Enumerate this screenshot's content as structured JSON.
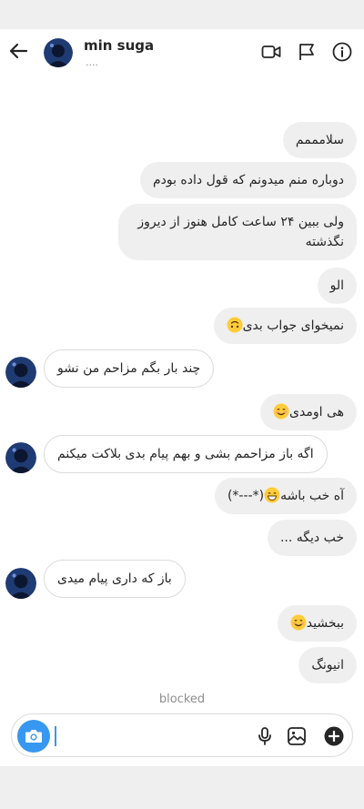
{
  "header": {
    "contact_name": "min suga",
    "status": "....",
    "icons": [
      "back-arrow-icon",
      "video-call-icon",
      "flag-icon",
      "info-icon"
    ]
  },
  "messages": [
    {
      "dir": "sent",
      "text": "سلامممم"
    },
    {
      "dir": "sent",
      "text": "دوباره منم میدونم که قول داده بودم"
    },
    {
      "dir": "sent",
      "text": "ولی ببین ۲۴ ساعت کامل هنوز از دیروز\nنگذشته"
    },
    {
      "dir": "sent",
      "text": "الو"
    },
    {
      "dir": "sent",
      "text": "نمیخوای جواب بدی",
      "emoji": "upside-down-face"
    },
    {
      "dir": "received",
      "text": "چند بار بگم مزاحم من نشو"
    },
    {
      "dir": "sent",
      "text": "هی اومدی",
      "emoji": "smiling-face"
    },
    {
      "dir": "received",
      "text": "اگه باز مزاحمم بشی و بهم پیام بدی بلاکت میکنم"
    },
    {
      "dir": "sent",
      "text": "آه خب باشه",
      "text_suffix": "(*---*)",
      "emoji": "grinning-face"
    },
    {
      "dir": "sent",
      "text": "خب دیگه ..."
    },
    {
      "dir": "received",
      "text": "باز که داری پیام میدی"
    },
    {
      "dir": "sent",
      "text": "ببخشید",
      "emoji": "smiling-face"
    },
    {
      "dir": "sent",
      "text": "انیونگ"
    }
  ],
  "blocked_label": "blocked",
  "composer": {
    "icons": [
      "camera-icon",
      "microphone-icon",
      "gallery-icon",
      "add-icon"
    ],
    "accent": "#3897f0"
  },
  "colors": {
    "sent_bubble": "#efefef",
    "received_border": "#dbdbdb",
    "muted_text": "#8e8e8e",
    "system_bar": "#efefef"
  }
}
